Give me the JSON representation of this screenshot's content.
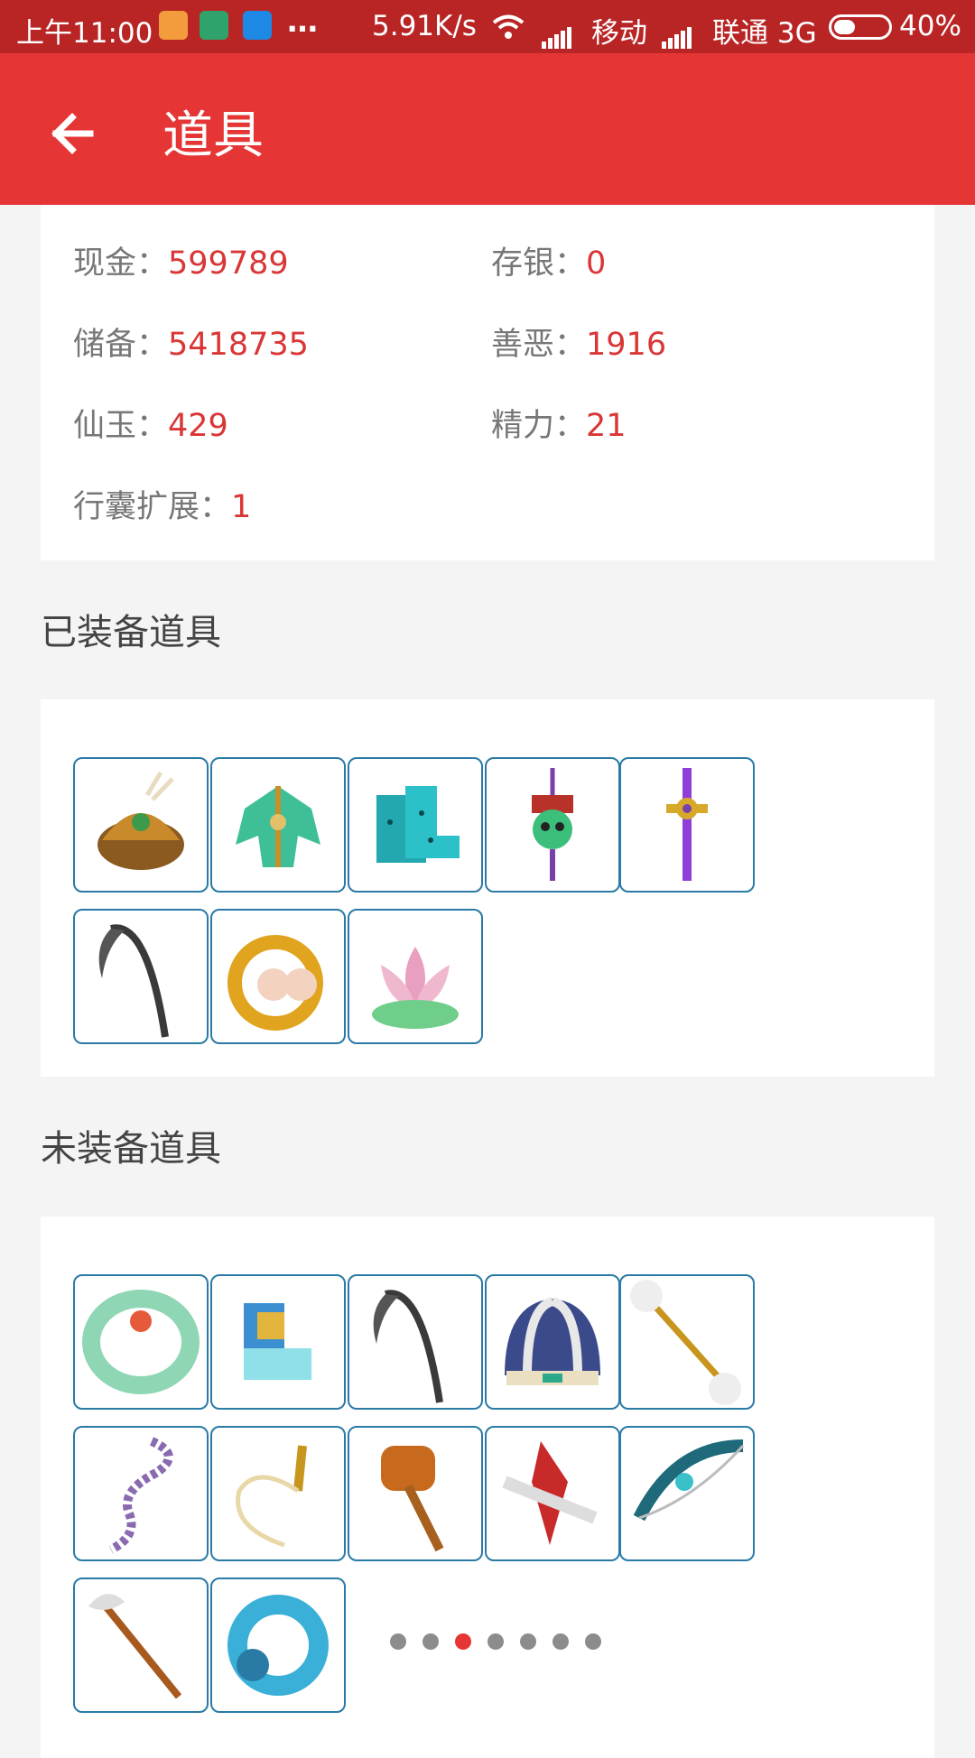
{
  "status_bar": {
    "time": "上午11:00",
    "speed": "5.91K/s",
    "carrier1": "移动",
    "carrier2": "联通 3G",
    "battery": "40%",
    "battery_level": 0.4
  },
  "app_bar": {
    "title": "道具",
    "back_icon": "arrow-left-icon"
  },
  "stats": {
    "cash": {
      "label": "现金：",
      "value": "599789"
    },
    "deposit": {
      "label": "存银：",
      "value": "0"
    },
    "reserve": {
      "label": "储备：",
      "value": "5418735"
    },
    "karma": {
      "label": "善恶：",
      "value": "1916"
    },
    "jade": {
      "label": "仙玉：",
      "value": "429"
    },
    "energy": {
      "label": "精力：",
      "value": "21"
    },
    "bag_expand": {
      "label": "行囊扩展：",
      "value": "1"
    }
  },
  "equipped": {
    "title": "已装备道具",
    "items": [
      "helmet-icon",
      "armor-icon",
      "boots-icon",
      "skull-pendant-icon",
      "sword-pendant-icon",
      "scythe-icon",
      "earring-icon",
      "lotus-icon"
    ]
  },
  "unequipped": {
    "title": "未装备道具",
    "items": [
      "bracelet-icon",
      "cloud-boots-icon",
      "scythe-icon",
      "hat-icon",
      "double-axe-staff-icon",
      "chain-whip-icon",
      "whip-icon",
      "hammer-icon",
      "claw-blade-icon",
      "bow-icon",
      "axe-icon",
      "dragon-ring-icon"
    ]
  },
  "pager": {
    "count": 7,
    "active_index": 2
  },
  "colors": {
    "accent": "#e53535",
    "value": "#d93636",
    "status_bar": "#b92525",
    "border": "#2a7aa6"
  }
}
